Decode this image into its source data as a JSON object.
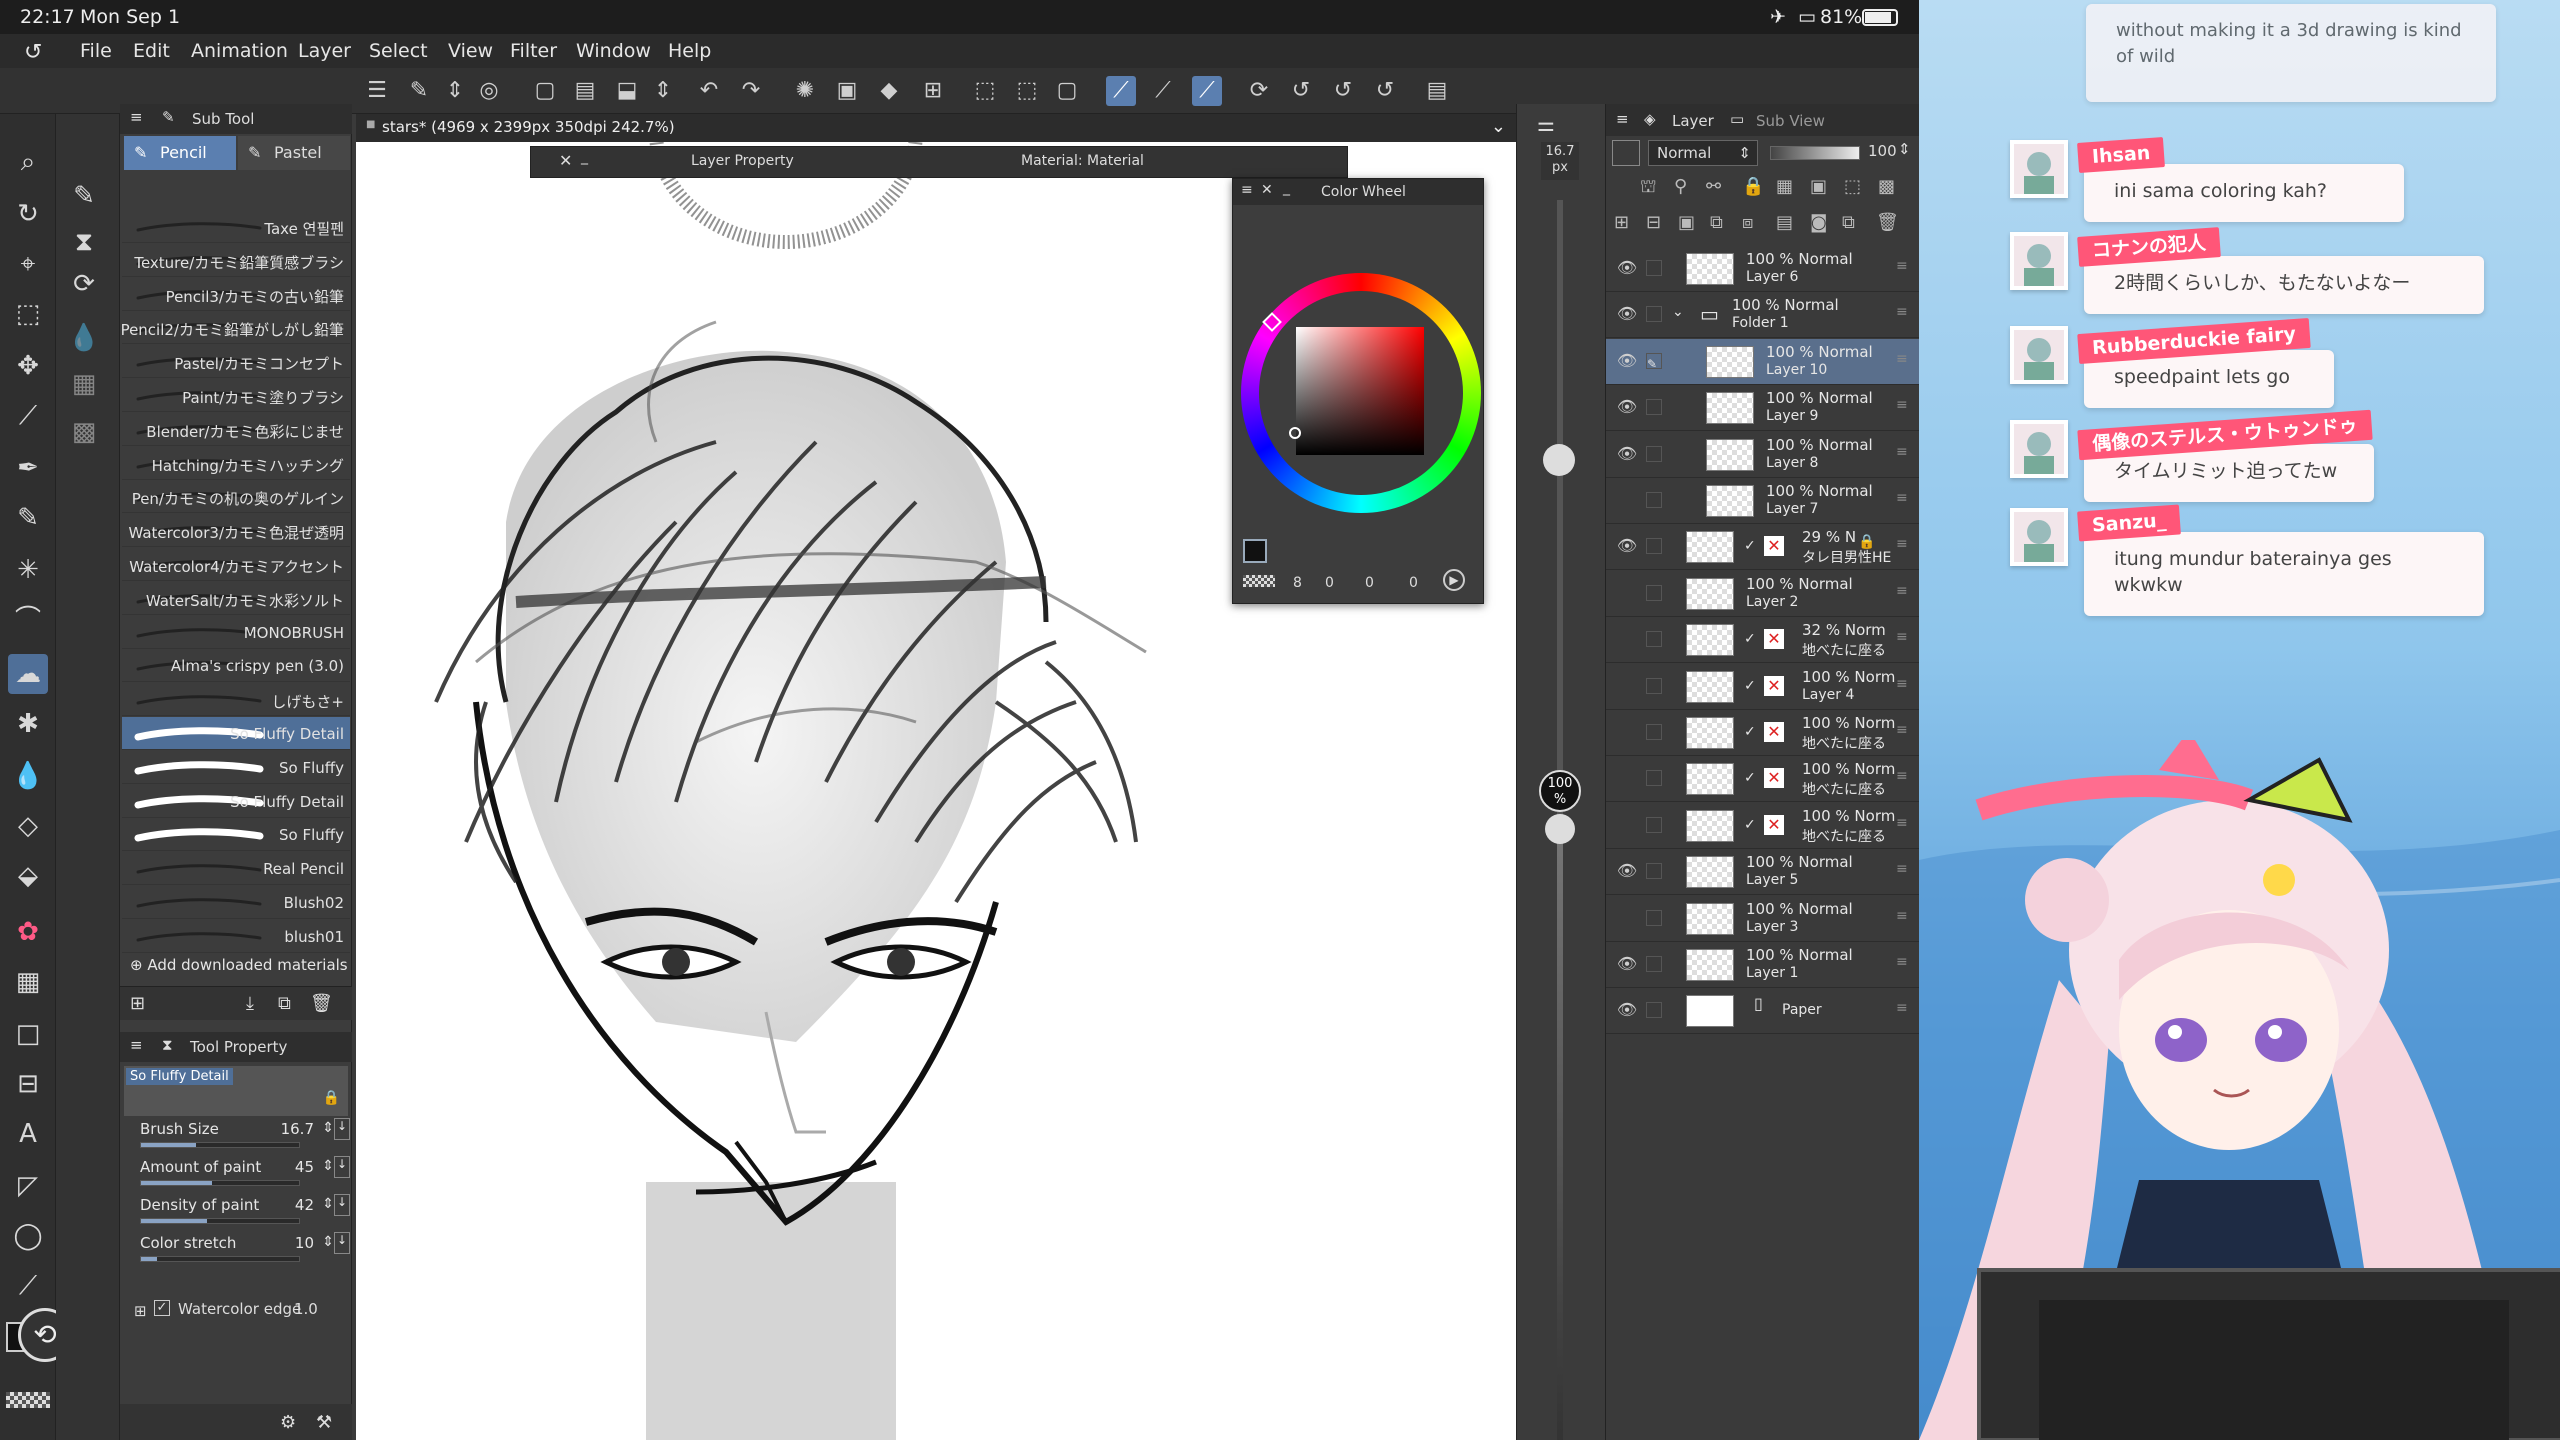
{
  "status": {
    "time": "22:17",
    "date": "Mon Sep 1",
    "battery": "81%"
  },
  "menu": [
    "File",
    "Edit",
    "Animation",
    "Layer",
    "Select",
    "View",
    "Filter",
    "Window",
    "Help"
  ],
  "subtool": {
    "header": "Sub Tool",
    "tabs": [
      "Pencil",
      "Pastel"
    ],
    "brushes": [
      "Taxe 연필펜",
      "Texture/カモミ鉛筆質感ブラシ",
      "Pencil3/カモミの古い鉛筆",
      "Pencil2/カモミ鉛筆がしがし鉛筆",
      "Pastel/カモミコンセプト",
      "Paint/カモミ塗りブラシ",
      "Blender/カモミ色彩にじませ",
      "Hatching/カモミハッチング",
      "Pen/カモミの机の奥のゲルイン",
      "Watercolor3/カモミ色混ぜ透明",
      "Watercolor4/カモミアクセント",
      "WaterSalt/カモミ水彩ソルト",
      "MONOBRUSH",
      "Alma's crispy pen (3.0)",
      "しげもさ+",
      "So Fluffy Detail",
      "So Fluffy",
      "So Fluffy Detail",
      "So Fluffy",
      "Real Pencil",
      "Blush02",
      "blush01"
    ],
    "selected_index": 15,
    "add_label": "Add downloaded materials"
  },
  "tool_property": {
    "header": "Tool Property",
    "brush_name": "So Fluffy Detail",
    "props": [
      {
        "label": "Brush Size",
        "value": "16.7",
        "fraction": 0.35
      },
      {
        "label": "Amount of paint",
        "value": "45",
        "fraction": 0.45
      },
      {
        "label": "Density of paint",
        "value": "42",
        "fraction": 0.42
      },
      {
        "label": "Color stretch",
        "value": "10",
        "fraction": 0.1
      }
    ],
    "watercolor_edge": {
      "label": "Watercolor edge",
      "value": "1.0"
    }
  },
  "document": {
    "title": "stars* (4969 x 2399px 350dpi 242.7%)"
  },
  "floating": {
    "layer_property": "Layer Property",
    "material": "Material: Material",
    "color_wheel": "Color Wheel",
    "color_values": [
      "8",
      "0",
      "0",
      "0"
    ]
  },
  "sizebar": {
    "size": "16.7",
    "size_unit": "px",
    "opacity": "100",
    "opacity_unit": "%"
  },
  "layers_panel": {
    "tabs": [
      "Layer",
      "Sub View"
    ],
    "blend": "Normal",
    "opacity": "100",
    "layers": [
      {
        "l1": "100 % Normal",
        "l2": "Layer 6",
        "indent": 0,
        "eye": true
      },
      {
        "l1": "100 % Normal",
        "l2": "Folder 1",
        "indent": 0,
        "eye": true,
        "folder": true
      },
      {
        "l1": "100 % Normal",
        "l2": "Layer 10",
        "indent": 1,
        "eye": true,
        "active": true
      },
      {
        "l1": "100 % Normal",
        "l2": "Layer 9",
        "indent": 1,
        "eye": true
      },
      {
        "l1": "100 % Normal",
        "l2": "Layer 8",
        "indent": 1,
        "eye": true
      },
      {
        "l1": "100 % Normal",
        "l2": "Layer 7",
        "indent": 1,
        "eye": false
      },
      {
        "l1": "29 % N",
        "l2": "タレ目男性HE",
        "indent": 0,
        "eye": true,
        "mat": true
      },
      {
        "l1": "100 % Normal",
        "l2": "Layer 2",
        "indent": 0,
        "eye": false
      },
      {
        "l1": "32 % Norm",
        "l2": "地べたに座る",
        "indent": 0,
        "eye": false,
        "mat": true
      },
      {
        "l1": "100 % Norm",
        "l2": "Layer 4",
        "indent": 0,
        "eye": false,
        "mat": true
      },
      {
        "l1": "100 % Norm",
        "l2": "地べたに座る",
        "indent": 0,
        "eye": false,
        "mat": true
      },
      {
        "l1": "100 % Norm",
        "l2": "地べたに座る",
        "indent": 0,
        "eye": false,
        "mat": true
      },
      {
        "l1": "100 % Norm",
        "l2": "地べたに座る",
        "indent": 0,
        "eye": false,
        "mat": true
      },
      {
        "l1": "100 % Normal",
        "l2": "Layer 5",
        "indent": 0,
        "eye": true
      },
      {
        "l1": "100 % Normal",
        "l2": "Layer 3",
        "indent": 0,
        "eye": false
      },
      {
        "l1": "100 % Normal",
        "l2": "Layer 1",
        "indent": 0,
        "eye": true
      },
      {
        "l1": "",
        "l2": "Paper",
        "indent": 0,
        "eye": true,
        "paper": true
      }
    ]
  },
  "chat": [
    {
      "name": "",
      "text": "without making it a 3d drawing is kind of wild"
    },
    {
      "name": "Ihsan",
      "text": "ini sama coloring kah?"
    },
    {
      "name": "コナンの犯人",
      "text": "2時間くらいしか、もたないよなー"
    },
    {
      "name": "Rubberduckie fairy",
      "text": "speedpaint lets go"
    },
    {
      "name": "偶像のステルス・ウトゥンドゥ",
      "text": "タイムリミット迫ってたw"
    },
    {
      "name": "Sanzu_",
      "text": "itung mundur baterainya ges wkwkw"
    }
  ],
  "colors": {
    "accent": "#5b7fb0",
    "chat_name": "#ff5678",
    "chat_bg": "#fdf6f7",
    "stream_bg": "#8fc6ec"
  }
}
